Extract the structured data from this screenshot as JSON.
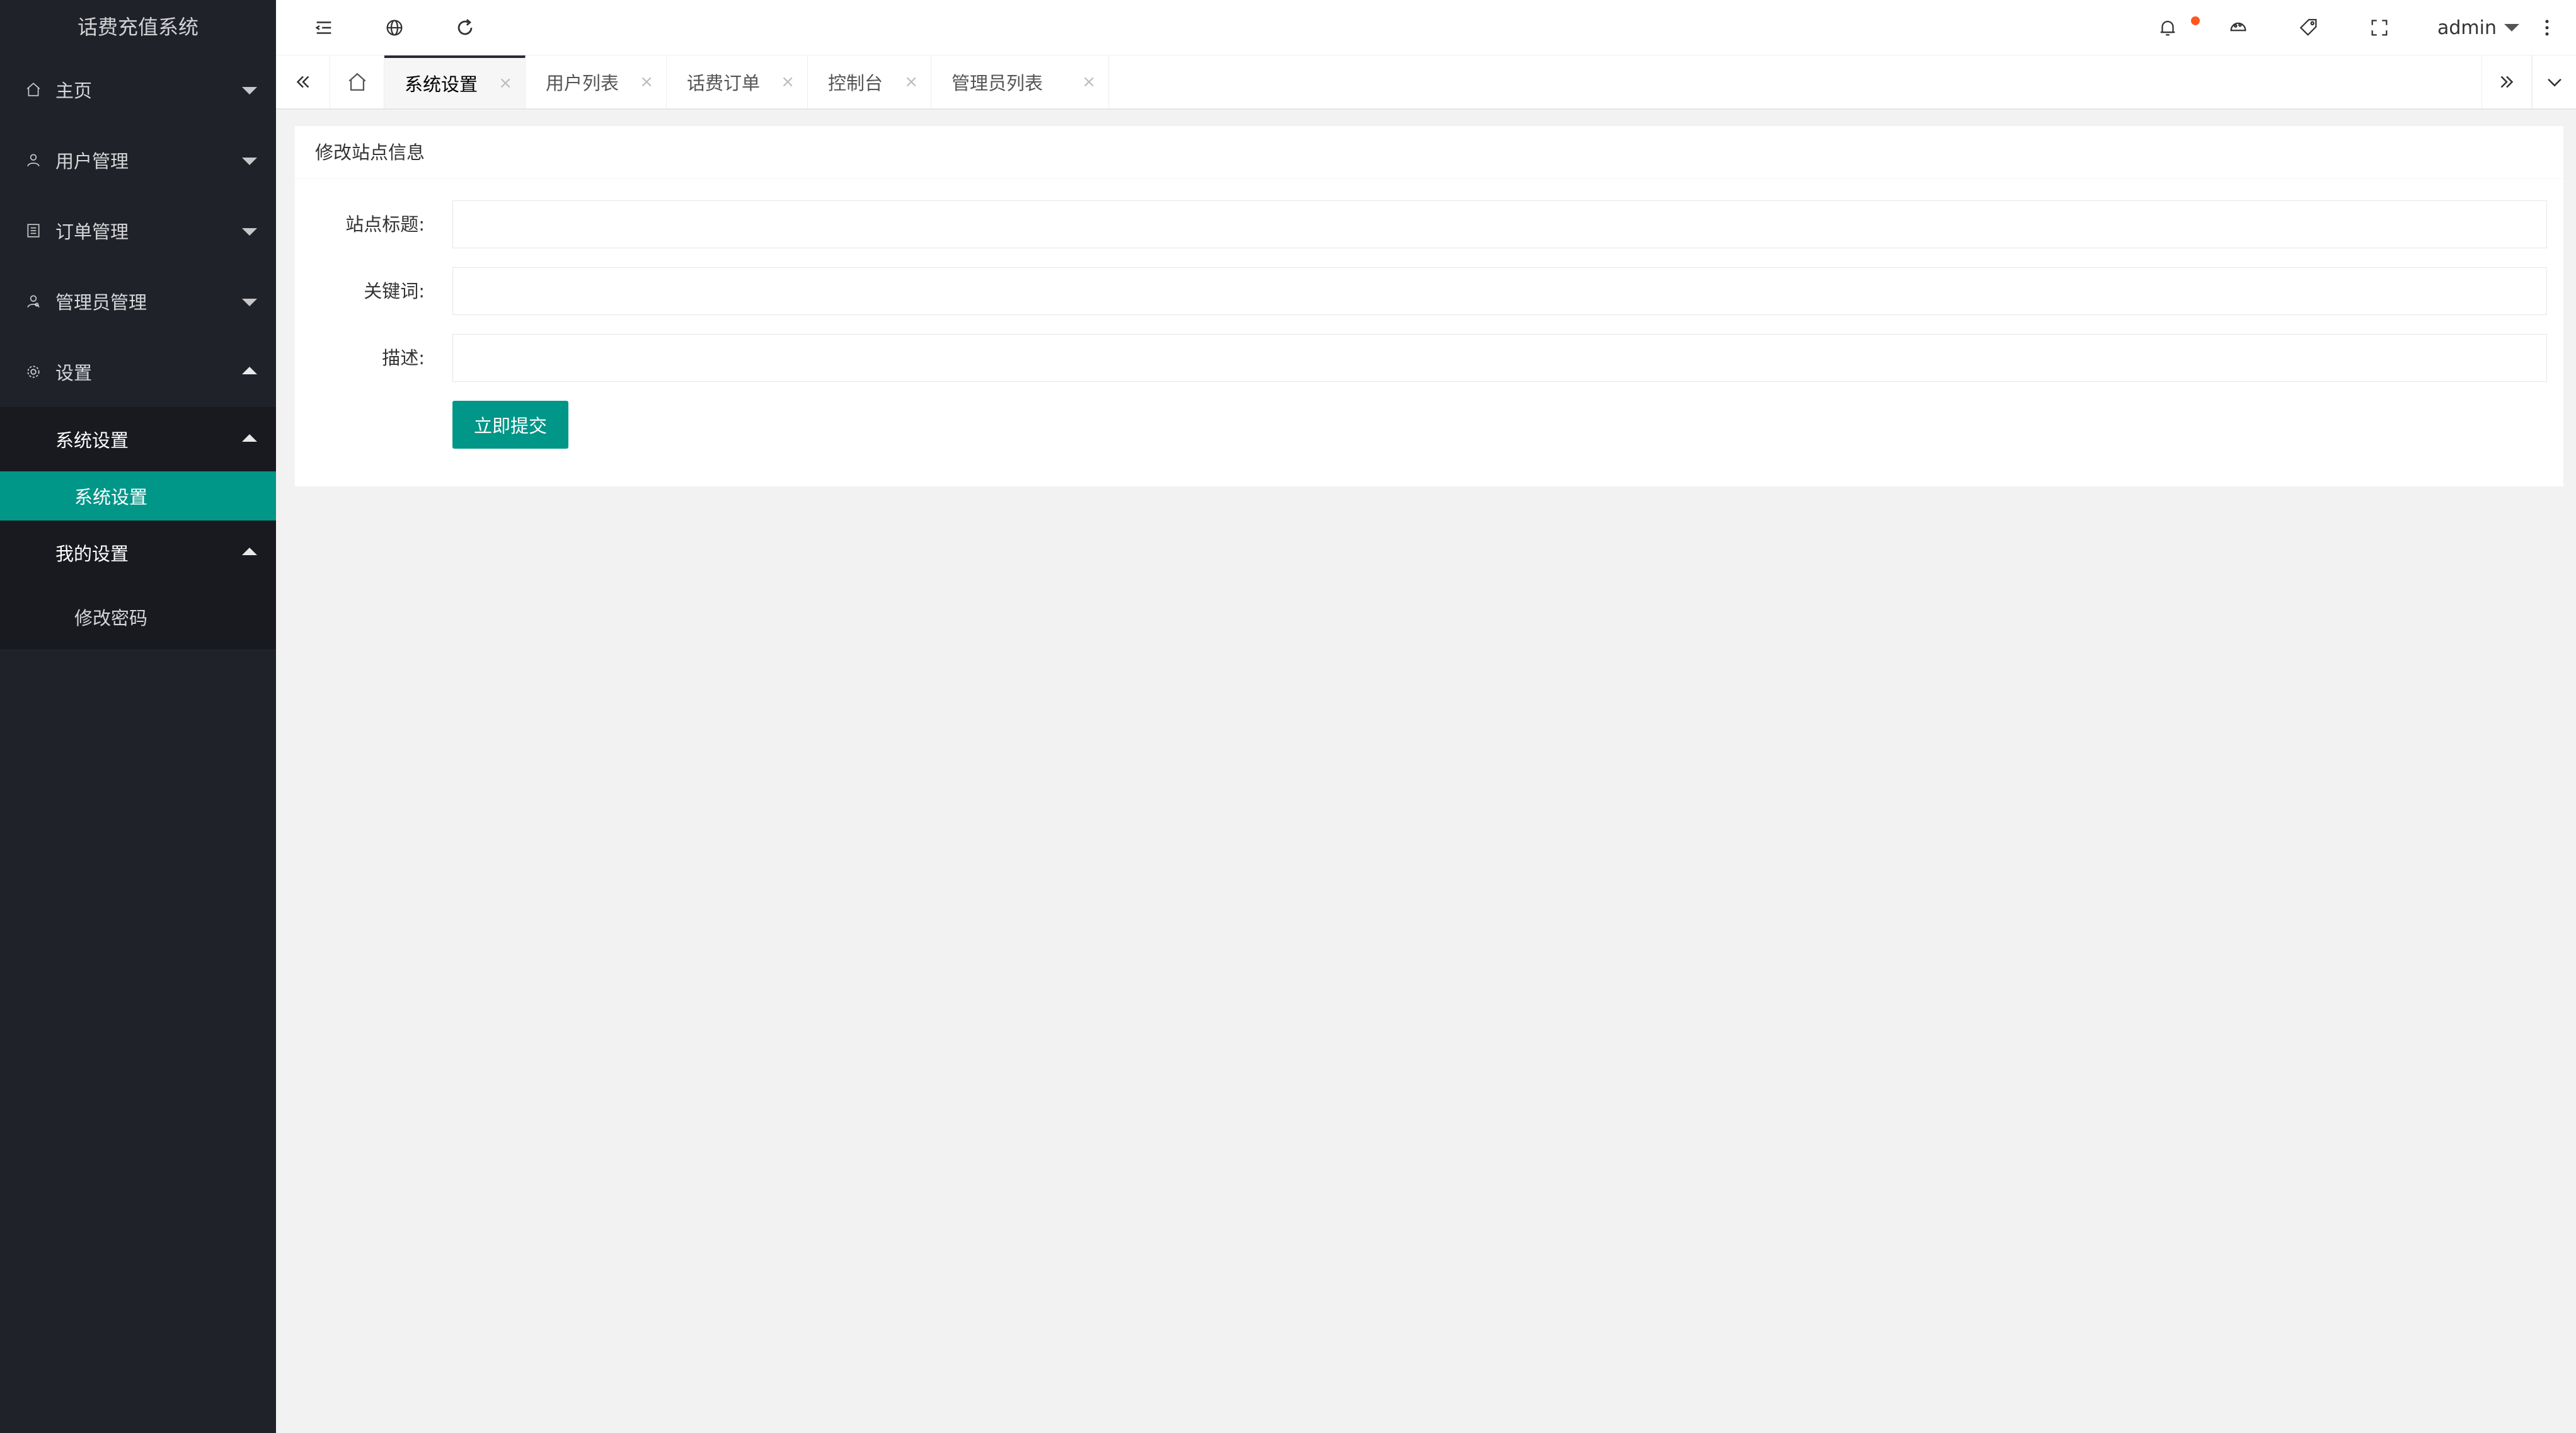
{
  "app": {
    "title": "话费充值系统"
  },
  "sidebar": {
    "items": [
      {
        "label": "主页",
        "icon": "home-icon"
      },
      {
        "label": "用户管理",
        "icon": "user-icon"
      },
      {
        "label": "订单管理",
        "icon": "order-icon"
      },
      {
        "label": "管理员管理",
        "icon": "admin-icon"
      },
      {
        "label": "设置",
        "icon": "gear-icon"
      }
    ],
    "settings_sub": {
      "system_group": "系统设置",
      "system_leaf": "系统设置",
      "my_group": "我的设置",
      "my_leaf": "修改密码"
    }
  },
  "header": {
    "user": "admin",
    "icons": [
      "menu-toggle-icon",
      "globe-icon",
      "refresh-icon",
      "bell-icon",
      "theme-icon",
      "tag-icon",
      "fullscreen-icon",
      "more-icon"
    ],
    "notification_dot_color": "#ff5722"
  },
  "tabs": [
    {
      "label": "系统设置",
      "active": true
    },
    {
      "label": "用户列表"
    },
    {
      "label": "话费订单"
    },
    {
      "label": "控制台"
    },
    {
      "label": "管理员列表"
    }
  ],
  "tab_close_symbol": "×",
  "form": {
    "title": "修改站点信息",
    "fields": [
      {
        "label": "站点标题:",
        "value": ""
      },
      {
        "label": "关键词:",
        "value": ""
      },
      {
        "label": "描述:",
        "value": ""
      }
    ],
    "submit_label": "立即提交"
  },
  "colors": {
    "sidebar": "#20222a",
    "accent": "#009688",
    "background": "#f2f2f2"
  }
}
